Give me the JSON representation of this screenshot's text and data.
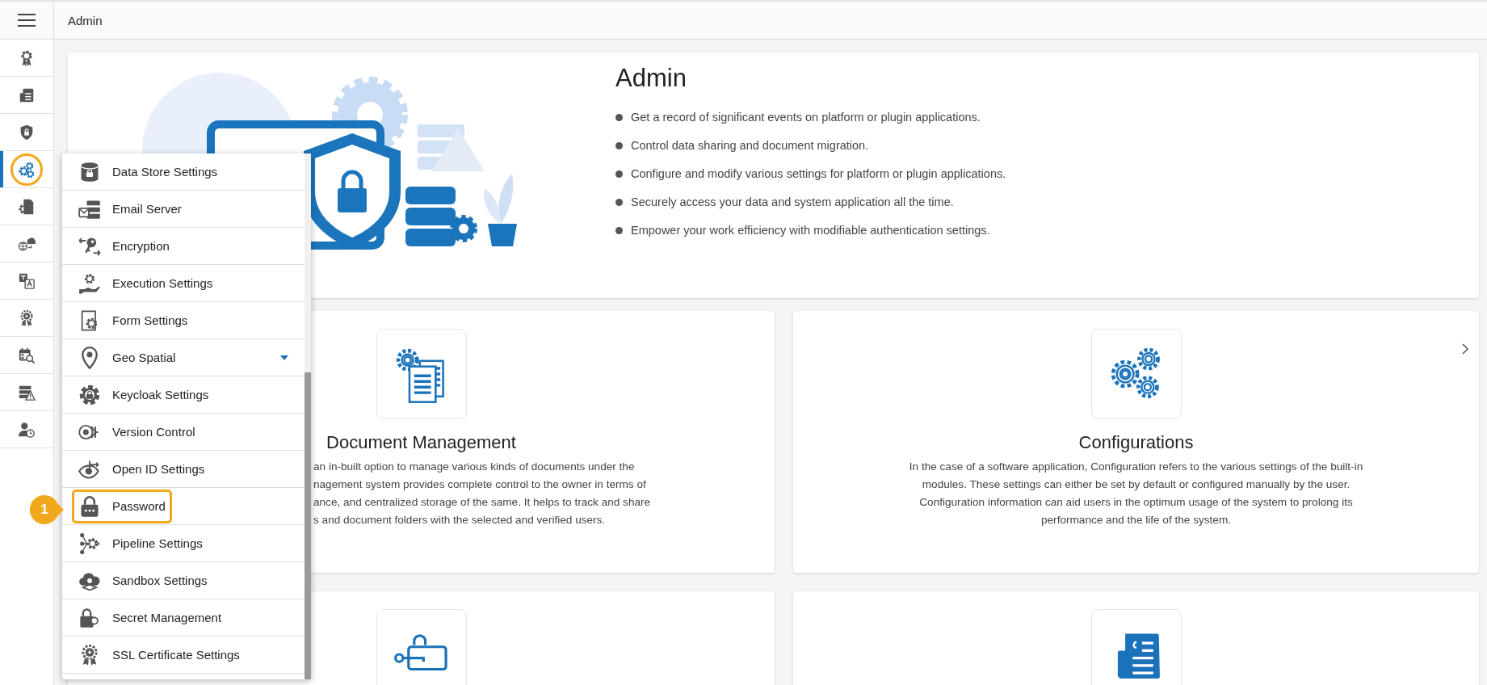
{
  "topbar": {
    "title": "Admin"
  },
  "sidebar": {
    "items": [
      {
        "kind": "award",
        "selected": false,
        "outlined": false
      },
      {
        "kind": "invoice",
        "selected": false,
        "outlined": false
      },
      {
        "kind": "shield",
        "selected": false,
        "outlined": false
      },
      {
        "kind": "gears",
        "selected": true,
        "outlined": true
      },
      {
        "kind": "docgear",
        "selected": false,
        "outlined": false
      },
      {
        "kind": "globecloud",
        "selected": false,
        "outlined": false
      },
      {
        "kind": "translate",
        "selected": false,
        "outlined": false
      },
      {
        "kind": "certificate",
        "selected": false,
        "outlined": false
      },
      {
        "kind": "calsearch",
        "selected": false,
        "outlined": false
      },
      {
        "kind": "serverwarn",
        "selected": false,
        "outlined": false
      },
      {
        "kind": "userclock",
        "selected": false,
        "outlined": false
      }
    ]
  },
  "hero": {
    "title": "Admin",
    "bullets": [
      "Get a record of significant events on platform or plugin applications.",
      "Control data sharing and document migration.",
      "Configure and modify various settings for platform or plugin applications.",
      "Securely access your data and system application all the time.",
      "Empower your work efficiency with modifiable authentication settings."
    ]
  },
  "cards": [
    {
      "kind": "documents",
      "title": "Document Management",
      "arrow": false,
      "description_lines": [
        "an in-built option to manage various kinds of documents under the",
        "nagement system provides complete control to the owner in terms of",
        "ance, and centralized storage of the same. It helps to track and share",
        "s and document folders with the selected and verified users."
      ]
    },
    {
      "kind": "gears",
      "title": "Configurations",
      "arrow": true,
      "description_lines": [
        "In the case of a software application, Configuration refers to the various settings of the built-in",
        "modules. These settings can either be set by default or configured manually by the user.",
        "Configuration information can aid users in the optimum usage of the system to prolong its",
        "performance and the life of the system."
      ]
    },
    {
      "kind": "lockkey",
      "arrow": false
    },
    {
      "kind": "invoice",
      "arrow": false
    }
  ],
  "menu": {
    "items": [
      {
        "label": "Data Store Settings",
        "kind": "dblock",
        "submenu": false,
        "outlined": false
      },
      {
        "label": "Email Server",
        "kind": "mailserver",
        "submenu": false,
        "outlined": false
      },
      {
        "label": "Encryption",
        "kind": "keyarrows",
        "submenu": false,
        "outlined": false
      },
      {
        "label": "Execution Settings",
        "kind": "handgear",
        "submenu": false,
        "outlined": false
      },
      {
        "label": "Form Settings",
        "kind": "formgear",
        "submenu": false,
        "outlined": false
      },
      {
        "label": "Geo Spatial",
        "kind": "pin",
        "submenu": true,
        "outlined": false
      },
      {
        "label": "Keycloak Settings",
        "kind": "gearlock",
        "submenu": false,
        "outlined": false
      },
      {
        "label": "Version Control",
        "kind": "version",
        "submenu": false,
        "outlined": false
      },
      {
        "label": "Open ID Settings",
        "kind": "eye",
        "submenu": false,
        "outlined": false
      },
      {
        "label": "Password",
        "kind": "lock",
        "submenu": false,
        "outlined": true
      },
      {
        "label": "Pipeline Settings",
        "kind": "pipeline",
        "submenu": false,
        "outlined": false
      },
      {
        "label": "Sandbox Settings",
        "kind": "cloud",
        "submenu": false,
        "outlined": false
      },
      {
        "label": "Secret Management",
        "kind": "lockkey",
        "submenu": false,
        "outlined": false
      },
      {
        "label": "SSL Certificate Settings",
        "kind": "certificate",
        "submenu": false,
        "outlined": false
      }
    ]
  },
  "callout": {
    "label": "1"
  }
}
